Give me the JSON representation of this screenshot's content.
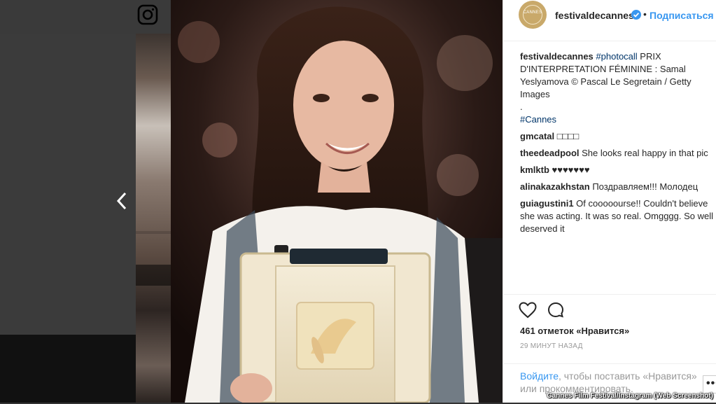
{
  "header": {
    "username": "festivaldecannes",
    "separator": "•",
    "follow_label": "Подписаться",
    "avatar_text": "CANNES"
  },
  "caption": {
    "user": "festivaldecannes",
    "hashtag": "#photocall",
    "text": " PRIX D'INTERPRETATION FÉMININE : Samal Yeslyamova © Pascal Le Segretain / Getty Images",
    "dot": ".",
    "hashtag2": "#Cannes"
  },
  "comments": [
    {
      "user": "gmcatal",
      "text": " □□□□"
    },
    {
      "user": "theedeadpool",
      "text": " She looks real happy in that pic"
    },
    {
      "user": "kmlktb",
      "text": " ♥♥♥♥♥♥♥"
    },
    {
      "user": "alinakazakhstan",
      "text": " Поздравляем!!! Молодец"
    },
    {
      "user": "guiagustini1",
      "text": " Of cooooourse!! Couldn't believe she was acting. It was so real. Omgggg. So well deserved it"
    }
  ],
  "likes": "461 отметок «Нравится»",
  "time": "29 МИНУТ НАЗАД",
  "login": {
    "link": "Войдите",
    "text": ", чтобы поставить «Нравится» или прокомментировать."
  },
  "more_label": "•••",
  "credit": "Cannes Film Festival/Instagram (Web Screenshot)",
  "icons": {
    "instagram": "instagram-icon",
    "prev": "chevron-left-icon",
    "verified": "verified-badge-icon",
    "like": "heart-icon",
    "comment": "comment-icon"
  },
  "colors": {
    "link": "#3897f0",
    "hashtag": "#003569",
    "text": "#262626",
    "muted": "#999999"
  }
}
